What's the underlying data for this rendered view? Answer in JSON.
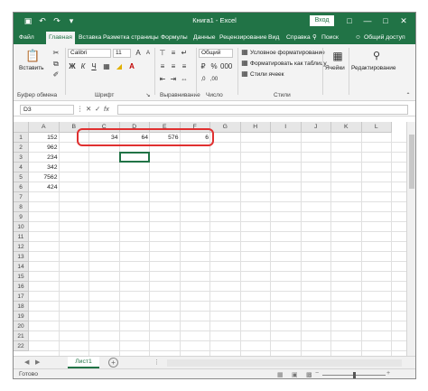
{
  "titlebar": {
    "title": "Книга1 - Excel",
    "signin_label": "Вход",
    "icons": [
      "save-icon",
      "undo-icon",
      "redo-icon",
      "customize-icon"
    ],
    "window_buttons": [
      "ribbon-display-icon",
      "minimize-icon",
      "maximize-icon",
      "close-icon"
    ]
  },
  "tabs": [
    {
      "label": "Файл",
      "active": false
    },
    {
      "label": "Главная",
      "active": true
    },
    {
      "label": "Вставка",
      "active": false
    },
    {
      "label": "Разметка страницы",
      "active": false
    },
    {
      "label": "Формулы",
      "active": false
    },
    {
      "label": "Данные",
      "active": false
    },
    {
      "label": "Рецензирование",
      "active": false
    },
    {
      "label": "Вид",
      "active": false
    },
    {
      "label": "Справка",
      "active": false
    },
    {
      "label": "Поиск",
      "active": false
    },
    {
      "label": "Общий доступ",
      "active": false
    }
  ],
  "ribbon": {
    "clipboard": {
      "paste_label": "Вставить",
      "group_label": "Буфер обмена"
    },
    "font": {
      "name": "Calibri",
      "size": "11",
      "group_label": "Шрифт"
    },
    "alignment": {
      "group_label": "Выравнивание"
    },
    "number": {
      "format": "Общий",
      "group_label": "Число"
    },
    "styles": {
      "conditional": "Условное форматирование",
      "as_table": "Форматировать как таблицу",
      "cell_styles": "Стили ячеек",
      "group_label": "Стили"
    },
    "cells": {
      "label": "Ячейки"
    },
    "editing": {
      "label": "Редактирование"
    }
  },
  "formula_bar": {
    "namebox": "D3",
    "formula": ""
  },
  "grid": {
    "columns": [
      "A",
      "B",
      "C",
      "D",
      "E",
      "F",
      "G",
      "H",
      "I",
      "J",
      "K",
      "L"
    ],
    "rows": [
      "1",
      "2",
      "3",
      "4",
      "5",
      "6",
      "7",
      "8",
      "9",
      "10",
      "11",
      "12",
      "13",
      "14",
      "15",
      "16",
      "17",
      "18",
      "19",
      "20",
      "21",
      "22"
    ],
    "cells": [
      {
        "col": "A",
        "row": 1,
        "value": "152"
      },
      {
        "col": "A",
        "row": 2,
        "value": "962"
      },
      {
        "col": "A",
        "row": 3,
        "value": "234"
      },
      {
        "col": "A",
        "row": 4,
        "value": "342"
      },
      {
        "col": "A",
        "row": 5,
        "value": "7562"
      },
      {
        "col": "A",
        "row": 6,
        "value": "424"
      },
      {
        "col": "C",
        "row": 1,
        "value": "34"
      },
      {
        "col": "D",
        "row": 1,
        "value": "64"
      },
      {
        "col": "E",
        "row": 1,
        "value": "576"
      },
      {
        "col": "F",
        "row": 1,
        "value": "6"
      }
    ],
    "active_cell": "D3",
    "highlight": {
      "from": "C1",
      "to": "F1",
      "color": "#e03030"
    }
  },
  "sheets": [
    {
      "label": "Лист1",
      "active": true
    }
  ],
  "status": {
    "text": "Готово"
  },
  "colors": {
    "accent": "#217346",
    "highlight": "#e03030"
  }
}
